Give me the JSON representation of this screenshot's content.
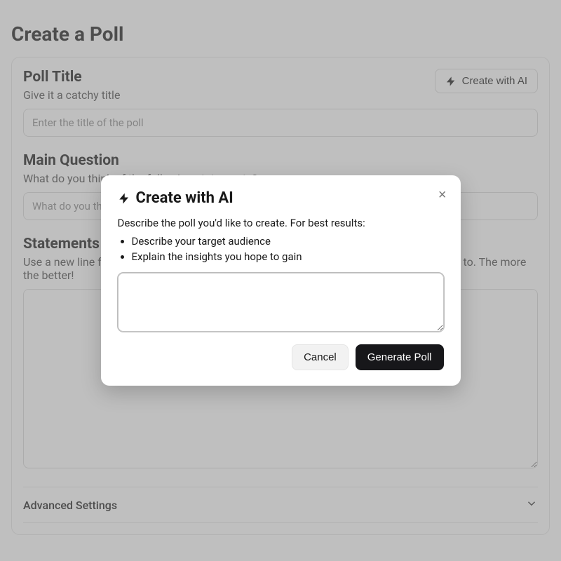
{
  "page": {
    "title": "Create a Poll"
  },
  "pollTitle": {
    "label": "Poll Title",
    "subtitle": "Give it a catchy title",
    "placeholder": "Enter the title of the poll"
  },
  "aiButton": {
    "label": "Create with AI"
  },
  "mainQuestion": {
    "label": "Main Question",
    "subtitle": "What do you think of the following statements?",
    "placeholder": "What do you think of the following statements?"
  },
  "statements": {
    "label": "Statements",
    "subtitle": "Use a new line for each statement. Add at least five statements that people can respond to. The more the better!"
  },
  "advanced": {
    "label": "Advanced Settings"
  },
  "modal": {
    "title": "Create with AI",
    "description": "Describe the poll you'd like to create. For best results:",
    "bullets": [
      "Describe your target audience",
      "Explain the insights you hope to gain"
    ],
    "cancel": "Cancel",
    "generate": "Generate Poll"
  }
}
